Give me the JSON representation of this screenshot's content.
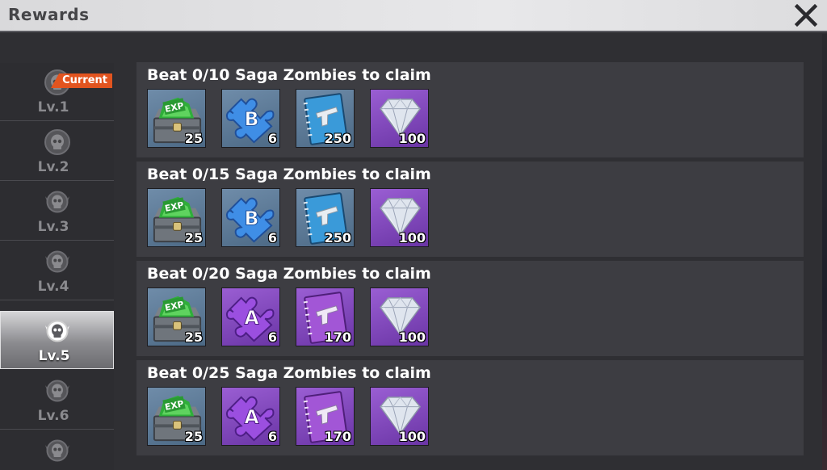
{
  "header": {
    "title": "Rewards"
  },
  "sidebar": {
    "current_label": "Current",
    "levels": [
      {
        "label": "Lv.1"
      },
      {
        "label": "Lv.2"
      },
      {
        "label": "Lv.3"
      },
      {
        "label": "Lv.4"
      },
      {
        "label": "Lv.5",
        "selected": true
      },
      {
        "label": "Lv.6"
      },
      {
        "label": ""
      }
    ]
  },
  "rewards": [
    {
      "title": "Beat 0/10 Saga Zombies to claim",
      "items": [
        {
          "icon": "exp-chest-icon",
          "qty": "25"
        },
        {
          "icon": "blueprint-b-puzzle-icon",
          "qty": "6"
        },
        {
          "icon": "pistol-manual-blue-icon",
          "qty": "250"
        },
        {
          "icon": "diamond-icon",
          "qty": "100"
        }
      ]
    },
    {
      "title": "Beat 0/15 Saga Zombies to claim",
      "items": [
        {
          "icon": "exp-chest-icon",
          "qty": "25"
        },
        {
          "icon": "blueprint-b-puzzle-icon",
          "qty": "6"
        },
        {
          "icon": "pistol-manual-blue-icon",
          "qty": "250"
        },
        {
          "icon": "diamond-icon",
          "qty": "100"
        }
      ]
    },
    {
      "title": "Beat 0/20 Saga Zombies to claim",
      "items": [
        {
          "icon": "exp-chest-icon",
          "qty": "25"
        },
        {
          "icon": "blueprint-a-puzzle-icon",
          "qty": "6"
        },
        {
          "icon": "pistol-manual-purple-icon",
          "qty": "170"
        },
        {
          "icon": "diamond-icon",
          "qty": "100"
        }
      ]
    },
    {
      "title": "Beat 0/25 Saga Zombies to claim",
      "items": [
        {
          "icon": "exp-chest-icon",
          "qty": "25"
        },
        {
          "icon": "blueprint-a-puzzle-icon",
          "qty": "6"
        },
        {
          "icon": "pistol-manual-purple-icon",
          "qty": "170"
        },
        {
          "icon": "diamond-icon",
          "qty": "100"
        }
      ]
    }
  ],
  "colors": {
    "accent": "#e2541f",
    "panel": "#3d3d42",
    "background": "#2f2f33"
  }
}
